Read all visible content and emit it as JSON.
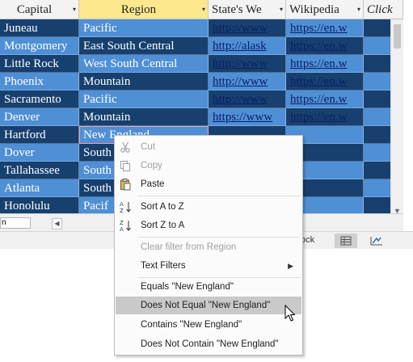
{
  "columns": {
    "capital": "Capital",
    "region": "Region",
    "states_web": "State's We",
    "wikipedia": "Wikipedia",
    "click": "Click"
  },
  "rows": [
    {
      "capital": "Juneau",
      "region": "Pacific",
      "web": "http://www",
      "wiki": "https://en.w"
    },
    {
      "capital": "Montgomery",
      "region": "East South Central",
      "web": "http://alask",
      "wiki": "https://en.w"
    },
    {
      "capital": "Little Rock",
      "region": "West South Central",
      "web": "http://www",
      "wiki": "https://en.w"
    },
    {
      "capital": "Phoenix",
      "region": "Mountain",
      "web": "http://www",
      "wiki": "https://en.w"
    },
    {
      "capital": "Sacramento",
      "region": "Pacific",
      "web": "http://www",
      "wiki": "https://en.w"
    },
    {
      "capital": "Denver",
      "region": "Mountain",
      "web": "https://www",
      "wiki": "https://en.w"
    },
    {
      "capital": "Hartford",
      "region": "New England",
      "web": "",
      "wiki": ""
    },
    {
      "capital": "Dover",
      "region": "South",
      "web": "",
      "wiki": ""
    },
    {
      "capital": "Tallahassee",
      "region": "South",
      "web": "",
      "wiki": ""
    },
    {
      "capital": "Atlanta",
      "region": "South",
      "web": "",
      "wiki": ""
    },
    {
      "capital": "Honolulu",
      "region": "Pacif",
      "web": "",
      "wiki": ""
    }
  ],
  "bottombar": {
    "search_value": "n"
  },
  "statusbar": {
    "label": "ock"
  },
  "context_menu": {
    "cut": "Cut",
    "copy": "Copy",
    "paste": "Paste",
    "sort_az": "Sort A to Z",
    "sort_za": "Sort Z to A",
    "clear_filter": "Clear filter from Region",
    "text_filters": "Text Filters",
    "equals": "Equals \"New England\"",
    "not_equal": "Does Not Equal \"New England\"",
    "contains": "Contains \"New England\"",
    "not_contain": "Does Not Contain \"New England\""
  },
  "colors": {
    "row_dark": "#17406f",
    "row_light": "#4f8fd6",
    "header_selected": "#fde88e",
    "menu_hover": "#c9c9c9"
  }
}
